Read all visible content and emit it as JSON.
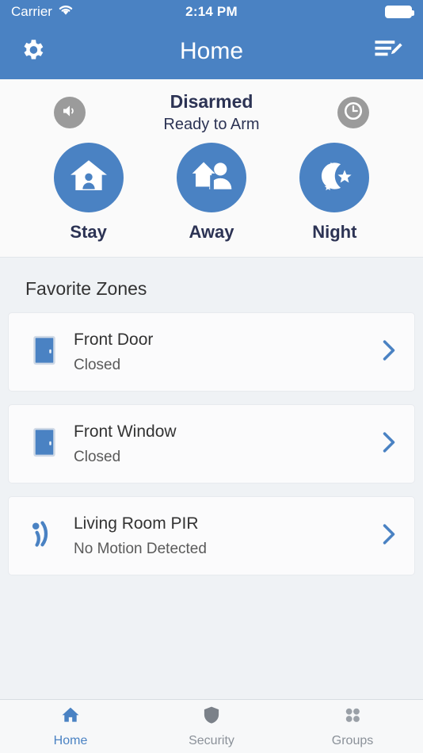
{
  "status_bar": {
    "carrier": "Carrier",
    "wifi_icon": "wifi-icon",
    "time": "2:14 PM",
    "battery_icon": "battery-full-icon"
  },
  "nav_bar": {
    "settings_icon": "gear-icon",
    "title": "Home",
    "edit_icon": "edit-list-icon"
  },
  "arm_panel": {
    "sound_button_icon": "speaker-icon",
    "history_button_icon": "clock-icon",
    "status": "Disarmed",
    "status_detail": "Ready to Arm",
    "modes": [
      {
        "label": "Stay",
        "icon": "house-person-icon"
      },
      {
        "label": "Away",
        "icon": "house-leaving-person-icon"
      },
      {
        "label": "Night",
        "icon": "moon-stars-icon"
      }
    ]
  },
  "zones": {
    "section_title": "Favorite Zones",
    "items": [
      {
        "name": "Front Door",
        "state": "Closed",
        "icon": "door-icon",
        "chevron": "chevron-right-icon"
      },
      {
        "name": "Front Window",
        "state": "Closed",
        "icon": "door-icon",
        "chevron": "chevron-right-icon"
      },
      {
        "name": "Living Room PIR",
        "state": "No Motion Detected",
        "icon": "motion-sensor-icon",
        "chevron": "chevron-right-icon"
      }
    ]
  },
  "tab_bar": {
    "tabs": [
      {
        "label": "Home",
        "icon": "home-icon",
        "active": true
      },
      {
        "label": "Security",
        "icon": "shield-icon",
        "active": false
      },
      {
        "label": "Groups",
        "icon": "grid-dots-icon",
        "active": false
      }
    ]
  },
  "colors": {
    "brand_blue": "#4a82c3",
    "navy_text": "#2c3354",
    "page_background": "#eff2f5",
    "panel_background": "#fafafa",
    "gray_icon_circle": "#9b9b9b",
    "inactive_tab": "#8b9199"
  }
}
